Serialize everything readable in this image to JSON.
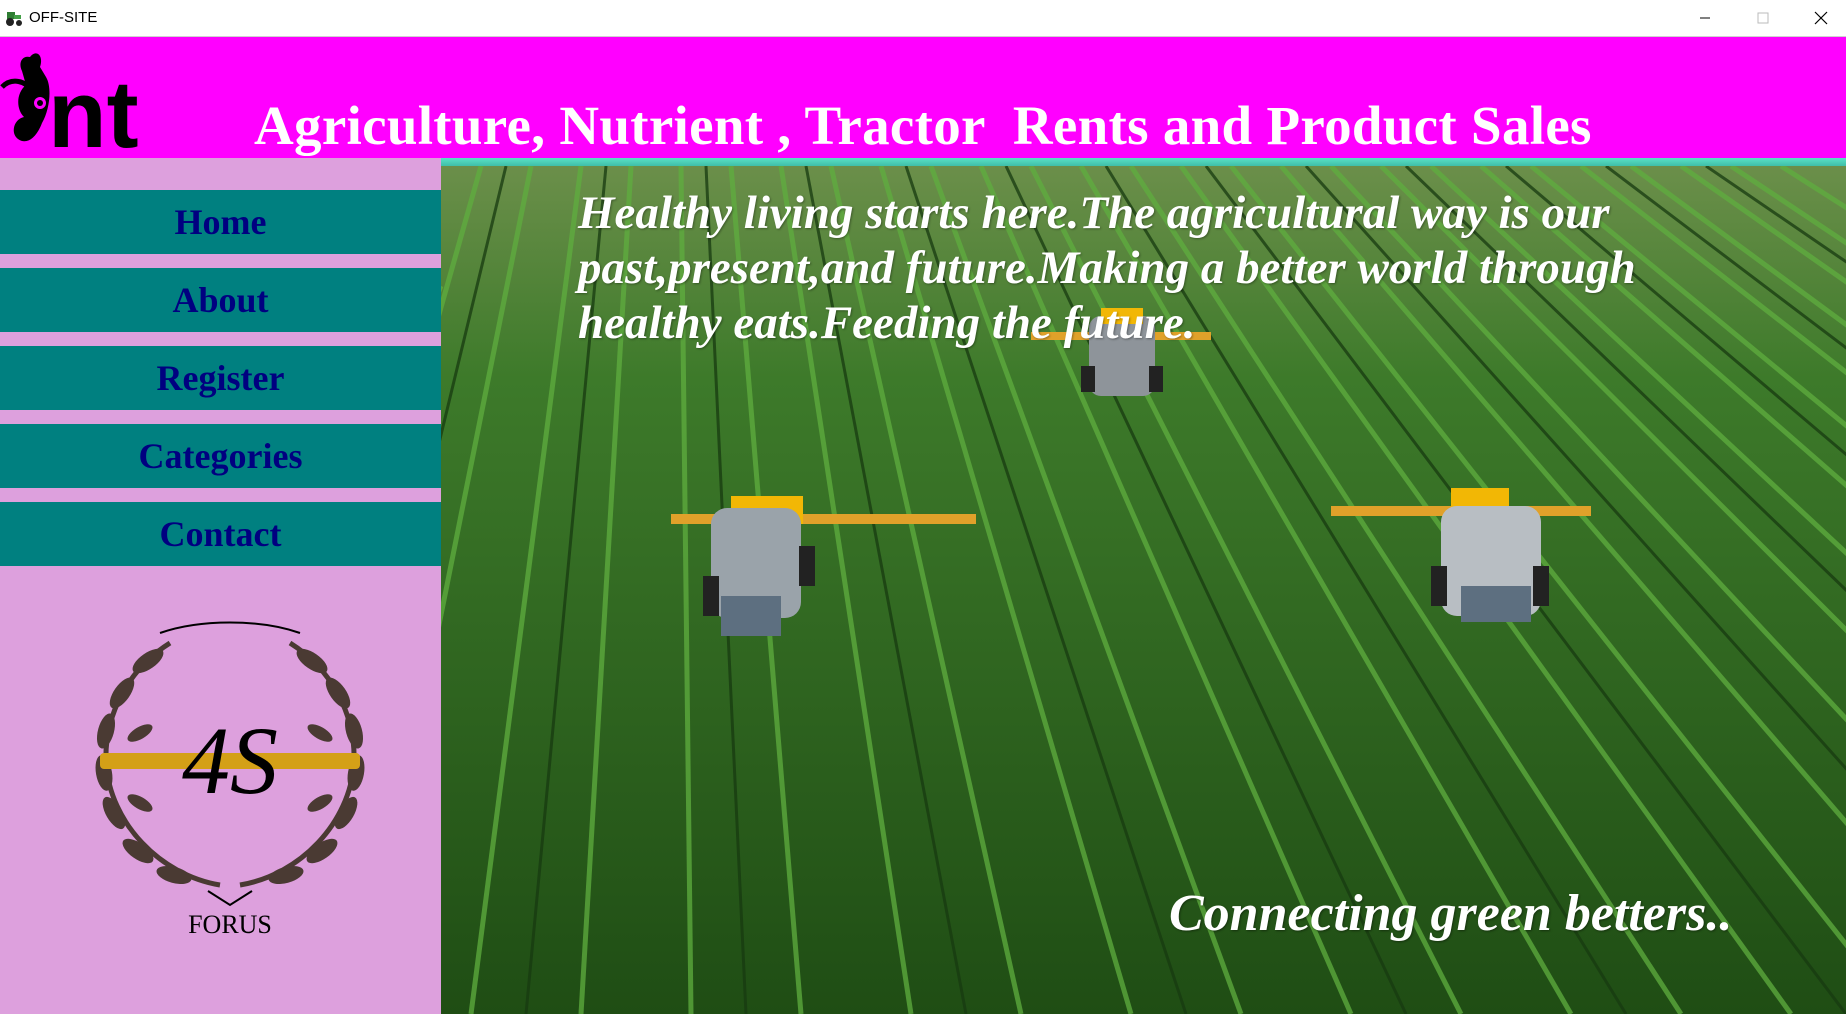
{
  "window": {
    "title": "OFF-SITE",
    "icon": "tractor-icon",
    "controls": [
      "minimize-icon",
      "maximize-icon",
      "close-icon"
    ]
  },
  "header": {
    "logo_text": "nt",
    "headline": "Agriculture, Nutrient , Tractor  Rents and Product Sales"
  },
  "nav": {
    "items": [
      {
        "label": "Home"
      },
      {
        "label": "About"
      },
      {
        "label": "Register"
      },
      {
        "label": "Categories"
      },
      {
        "label": "Contact"
      }
    ]
  },
  "seal": {
    "text": "4S",
    "caption": "FORUS"
  },
  "main": {
    "tagline": "Healthy living starts here.The agricultural way is our past,present,and future.Making a better world through healthy eats.Feeding the future.",
    "slogan": "Connecting green betters.."
  },
  "colors": {
    "header_bg": "#ff00ff",
    "sidebar_bg": "#dda0dd",
    "nav_button_bg": "#008080",
    "nav_text": "#000080",
    "accent_stripe": "#5be0c6"
  }
}
